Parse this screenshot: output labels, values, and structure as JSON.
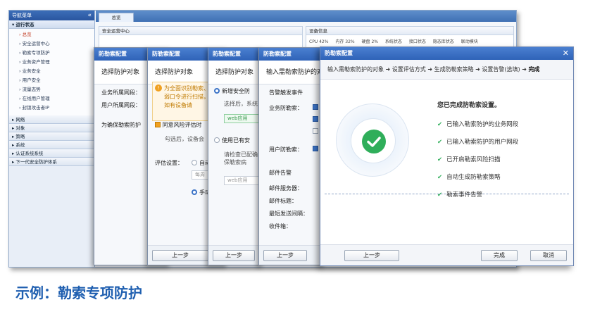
{
  "app": {
    "nav_title": "导航菜单",
    "collapse": "«",
    "group_running": "运行状态",
    "nav_items": [
      "总览",
      "安全运营中心",
      "勒索专项防护",
      "业务资产管理",
      "业务安全",
      "用户安全",
      "流量态势",
      "在线用户管理",
      "封锁攻击者IP"
    ],
    "nav_groups": [
      "网络",
      "对象",
      "策略",
      "系统",
      "认证系统系统",
      "下一代安全防护体系"
    ],
    "tab": "总览",
    "panel_left_title": "安全运营中心",
    "panel_right_title": "设备信息",
    "stats": [
      "CPU 42%",
      "内存 32%",
      "硬盘 2%",
      "系统状态",
      "接口状态",
      "隐态库状态",
      "联动模块"
    ]
  },
  "dialogs": {
    "title": "防勒索配置",
    "d1": {
      "head": "选择防护对象",
      "biz_label": "业务所属网段：",
      "user_label": "用户所属网段：",
      "ensure_label": "为确保勒索防护"
    },
    "d2": {
      "head": "选择防护对象",
      "warn": "为全面识别勒索、弱口令进行扫描，如有设备请",
      "checkbox_label": "同意风险评估时",
      "hint": "勾选后，设备会",
      "eval_label": "评估设置：",
      "opt_auto": "自动",
      "opt_manual": "手动",
      "period": "每周",
      "prev": "上一步"
    },
    "d3": {
      "head": "选择防护对象",
      "opt_new": "新增安全防",
      "hint_new": "选择后，系统",
      "tag": "web应用",
      "opt_existing": "使用已有安",
      "hint_exist": "请检查已配确保勒索病",
      "tag2": "web应用",
      "prev": "上一步"
    },
    "d4": {
      "head": "输入需勒索防护的对象",
      "alert_title": "告警触发事件",
      "biz_protect": "业务防勒索：",
      "user_protect": "用户防勒索：",
      "mail_alert": "邮件告警",
      "mail_server": "邮件服务器：",
      "mail_subject": "邮件标题：",
      "min_interval": "最短发送间隔：",
      "recipient": "收件箱：",
      "prev": "上一步"
    }
  },
  "final": {
    "title": "防勒索配置",
    "steps": [
      "输入需勒索防护的对象",
      "设置评估方式",
      "生成防勒索策略",
      "设置告警(选填)",
      "完成"
    ],
    "arrow": "➜",
    "done_title": "您已完成防勒索设置。",
    "items": [
      "已输入勒索防护的业务网段",
      "已输入勒索防护的用户网段",
      "已开启勒索风险扫描",
      "自动生成防勒索策略",
      "勒索事件告警"
    ],
    "tick": "✔",
    "prev": "上一步",
    "finish": "完成",
    "cancel": "取消",
    "close": "✕",
    "accent": "#2fae5a"
  },
  "caption": "示例：勒索专项防护"
}
